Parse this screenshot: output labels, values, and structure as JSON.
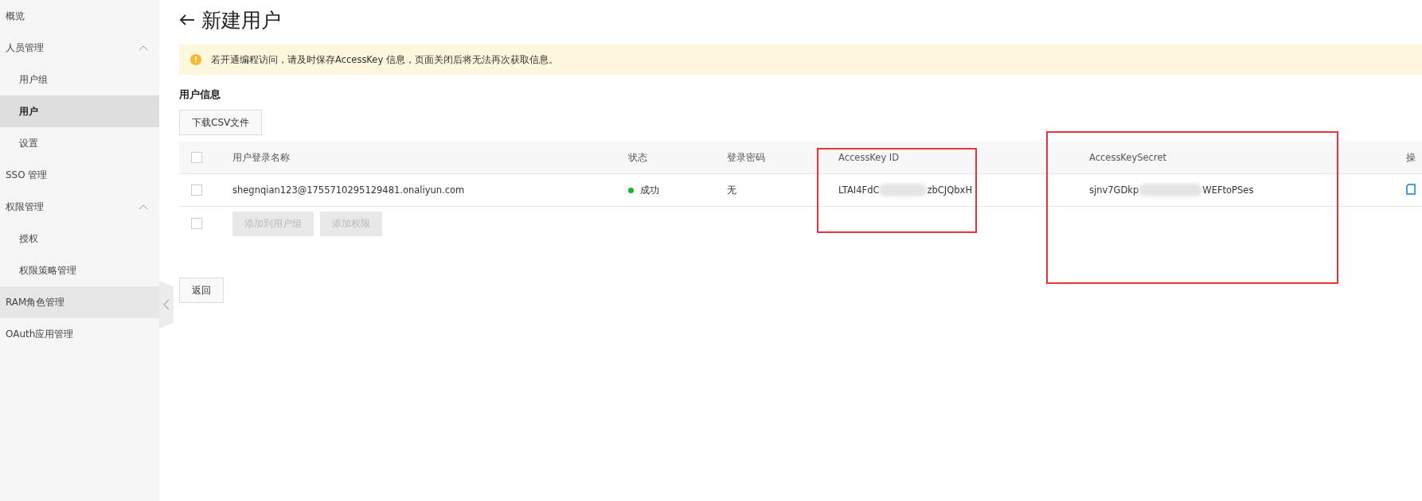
{
  "sidebar": {
    "items": [
      {
        "label": "概览",
        "hovered": false
      },
      {
        "label": "人员管理",
        "hovered": false,
        "expanded": true,
        "children": [
          {
            "label": "用户组",
            "selected": false
          },
          {
            "label": "用户",
            "selected": true
          },
          {
            "label": "设置",
            "selected": false
          }
        ]
      },
      {
        "label": "SSO 管理",
        "hovered": false
      },
      {
        "label": "权限管理",
        "hovered": false,
        "expanded": true,
        "children": [
          {
            "label": "授权",
            "selected": false
          },
          {
            "label": "权限策略管理",
            "selected": false
          }
        ]
      },
      {
        "label": "RAM角色管理",
        "hovered": true
      },
      {
        "label": "OAuth应用管理",
        "hovered": false
      }
    ]
  },
  "page": {
    "title": "新建用户",
    "notice": "若开通编程访问，请及时保存AccessKey 信息，页面关闭后将无法再次获取信息。",
    "section_title": "用户信息",
    "download_button": "下载CSV文件",
    "back_button": "返回"
  },
  "table": {
    "columns": [
      "用户登录名称",
      "状态",
      "登录密码",
      "AccessKey ID",
      "AccessKeySecret",
      "操"
    ],
    "rows": [
      {
        "checked": false,
        "login_name": "shegnqian123@1755710295129481.onaliyun.com",
        "status": "成功",
        "color": "#1ab22c",
        "password": "无",
        "access_key_id": {
          "start": "LTAI4FdC",
          "end": "zbCJQbxH"
        },
        "access_key_secret": {
          "start": "sjnv7GDkp",
          "end": "WEFtoPSes"
        }
      }
    ],
    "footer_buttons": [
      {
        "label": "添加到用户组",
        "disabled": true
      },
      {
        "label": "添加权限",
        "disabled": true
      }
    ],
    "select_all_checked": false,
    "footer_checked": false
  },
  "annotations": [
    {
      "kind": "highlight-box"
    },
    {
      "kind": "highlight-box"
    }
  ]
}
